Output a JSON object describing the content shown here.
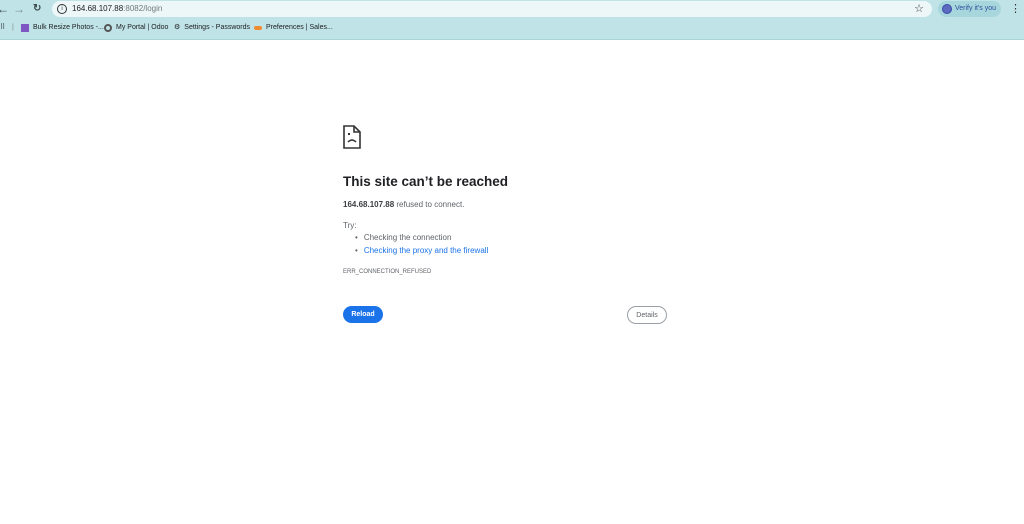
{
  "browser": {
    "url_host": "164.68.107.88",
    "url_rest": ":8082/login",
    "verify_label": "Verify it's you",
    "bookmarks": [
      {
        "label": "Bulk Resize Photos -...",
        "icon": "photo-icon",
        "color": "#7e57c2"
      },
      {
        "label": "My Portal | Odoo",
        "icon": "odoo-icon",
        "color": "#555"
      },
      {
        "label": "Settings - Passwords",
        "icon": "gear-icon",
        "color": "#222"
      },
      {
        "label": "Preferences | Sales...",
        "icon": "salesforce-icon",
        "color": "#f28b30"
      }
    ]
  },
  "error": {
    "title": "This site can’t be reached",
    "host": "164.68.107.88",
    "message": " refused to connect.",
    "try_label": "Try:",
    "suggestions": [
      "Checking the connection",
      "Checking the proxy and the firewall"
    ],
    "code": "ERR_CONNECTION_REFUSED",
    "reload_label": "Reload",
    "details_label": "Details"
  }
}
